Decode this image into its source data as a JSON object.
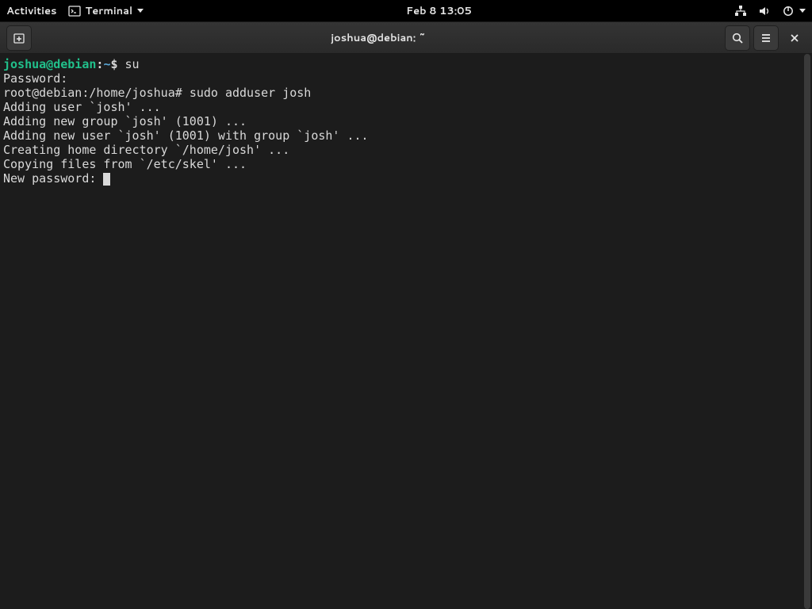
{
  "topbar": {
    "activities": "Activities",
    "app_name": "Terminal",
    "clock": "Feb 8  13:05"
  },
  "window": {
    "title": "joshua@debian: ~"
  },
  "terminal": {
    "prompt_user": "joshua@debian",
    "prompt_sep": ":",
    "prompt_path": "~",
    "prompt_dollar": "$ ",
    "cmd1": "su",
    "line_password": "Password:",
    "root_prompt": "root@debian:/home/joshua# ",
    "cmd2": "sudo adduser josh",
    "out1": "Adding user `josh' ...",
    "out2": "Adding new group `josh' (1001) ...",
    "out3": "Adding new user `josh' (1001) with group `josh' ...",
    "out4": "Creating home directory `/home/josh' ...",
    "out5": "Copying files from `/etc/skel' ...",
    "out6": "New password: "
  }
}
